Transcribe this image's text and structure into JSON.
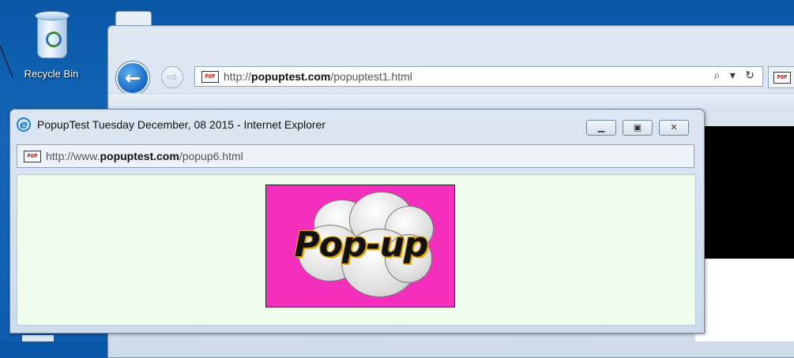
{
  "desktop": {
    "recycle_bin_label": "Recycle Bin"
  },
  "browser": {
    "back_icon": "arrow-left-icon",
    "forward_icon": "arrow-right-icon",
    "favicon_text": "POP",
    "url_prefix": "http://",
    "url_domain": "popuptest.com",
    "url_path": "/popuptest1.html",
    "tools": "⌕ ▾ ↻"
  },
  "popup": {
    "title": "PopupTest Tuesday December, 08 2015 - Internet Explorer",
    "favicon_text": "POP",
    "url_prefix": "http://www.",
    "url_domain": "popuptest.com",
    "url_path": "/popup6.html",
    "minimize_label": "▁",
    "restore_label": "▣",
    "close_label": "✕",
    "image_text": "Pop-up",
    "image_bg": "#f52fbd"
  }
}
